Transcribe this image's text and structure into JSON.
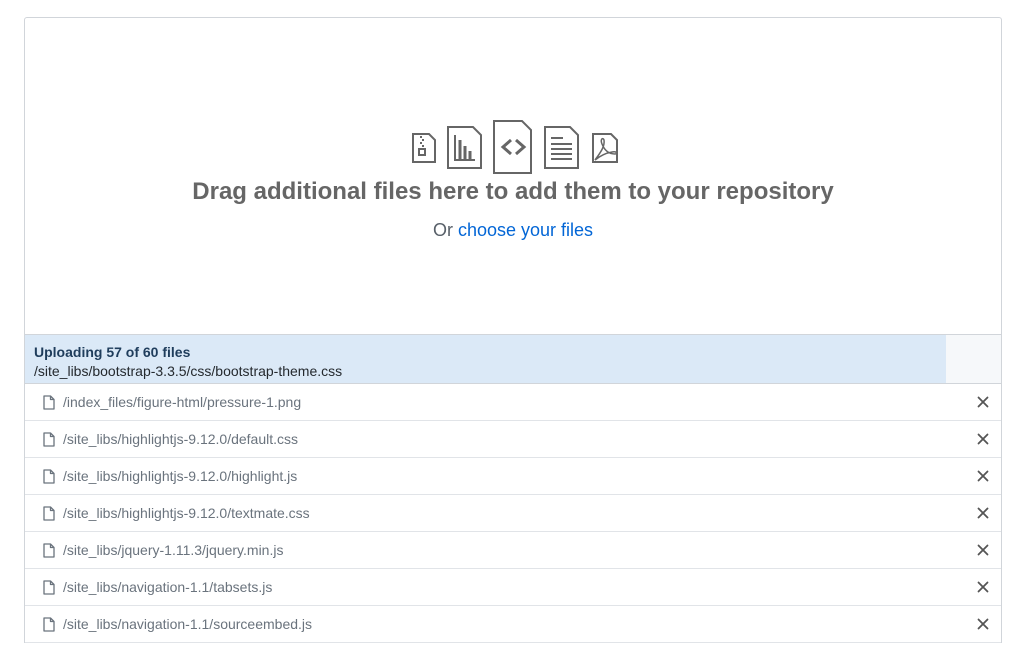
{
  "dropzone": {
    "title": "Drag additional files here to add them to your repository",
    "sub_prefix": "Or ",
    "choose_link": "choose your files",
    "icons": [
      "file-zip-icon",
      "file-chart-icon",
      "file-code-icon",
      "file-text-icon",
      "file-pdf-icon"
    ]
  },
  "progress": {
    "title": "Uploading 57 of 60 files",
    "current_file": "/site_libs/bootstrap-3.3.5/css/bootstrap-theme.css",
    "fraction": 0.944
  },
  "files": [
    {
      "name": "/index_files/figure-html/pressure-1.png"
    },
    {
      "name": "/site_libs/highlightjs-9.12.0/default.css"
    },
    {
      "name": "/site_libs/highlightjs-9.12.0/highlight.js"
    },
    {
      "name": "/site_libs/highlightjs-9.12.0/textmate.css"
    },
    {
      "name": "/site_libs/jquery-1.11.3/jquery.min.js"
    },
    {
      "name": "/site_libs/navigation-1.1/tabsets.js"
    },
    {
      "name": "/site_libs/navigation-1.1/sourceembed.js"
    }
  ],
  "colors": {
    "link": "#0366d6",
    "progress_fill": "#dbe9f7",
    "progress_track": "#f6f8fa"
  }
}
